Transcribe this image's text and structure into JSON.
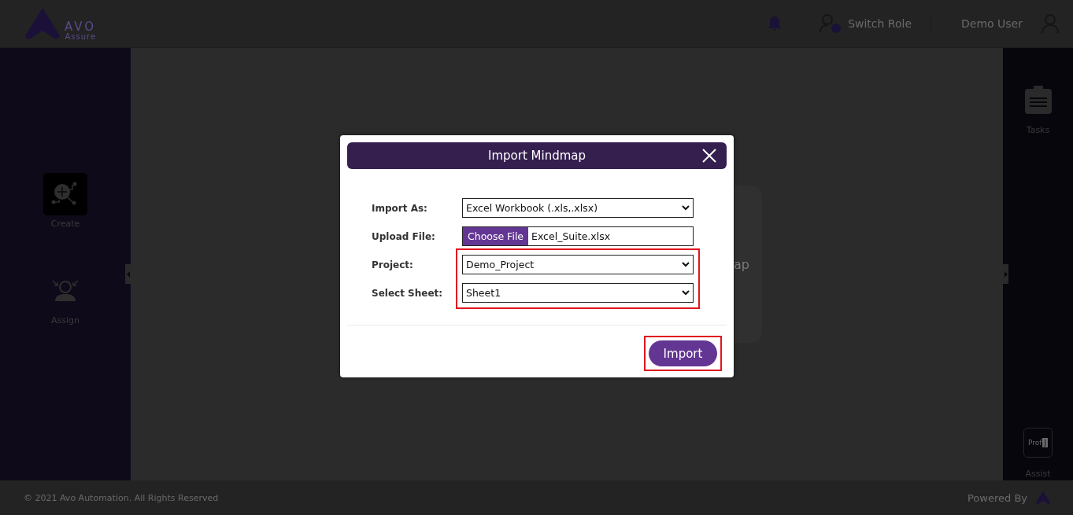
{
  "header": {
    "logo": {
      "word": "AVO",
      "tagline": "Assure"
    },
    "switch_role": "Switch Role",
    "user": "Demo User"
  },
  "left_sidebar": {
    "items": [
      {
        "label": "Create",
        "kind": "create",
        "selected": true
      },
      {
        "label": "Assign",
        "kind": "assign",
        "selected": false
      }
    ]
  },
  "right_sidebar": {
    "tasks": "Tasks",
    "assist": {
      "badge_word": "Prof",
      "badge_letter": "J",
      "label": "Assist"
    }
  },
  "background_card": {
    "text": "ap"
  },
  "dialog": {
    "title": "Import Mindmap",
    "field_groups": [
      {
        "highlighted": false,
        "fields": [
          {
            "label": "Import As:",
            "kind": "select",
            "value": "Excel Workbook (.xls,.xlsx)"
          },
          {
            "label": "Upload File:",
            "kind": "file",
            "button": "Choose File",
            "value": "Excel_Suite.xlsx"
          }
        ]
      },
      {
        "highlighted": true,
        "fields": [
          {
            "label": "Project:",
            "kind": "select",
            "value": "Demo_Project"
          },
          {
            "label": "Select Sheet:",
            "kind": "select",
            "value": "Sheet1"
          }
        ]
      }
    ],
    "import_button": {
      "label": "Import",
      "highlighted": true
    }
  },
  "footer": {
    "copyright": "© 2021 Avo Automation. All Rights Reserved",
    "powered_by": "Powered By"
  }
}
